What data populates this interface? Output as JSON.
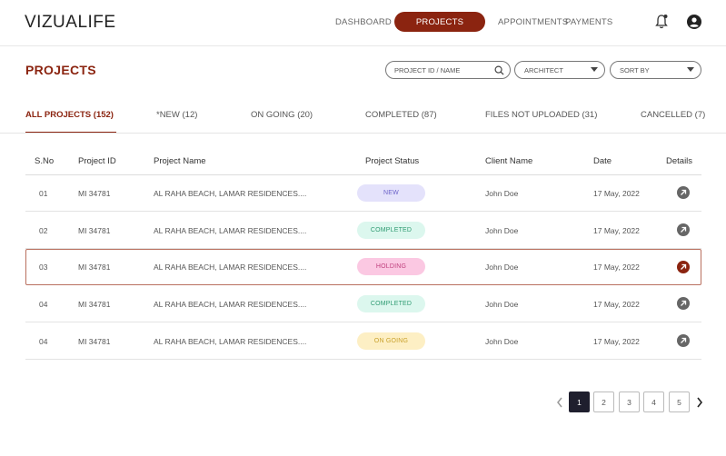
{
  "app": {
    "logo": "VIZUALIFE"
  },
  "nav": {
    "items": [
      {
        "label": "DASHBOARD"
      },
      {
        "label": "PROJECTS"
      },
      {
        "label": "APPOINTMENTS"
      },
      {
        "label": "PAYMENTS"
      }
    ],
    "active": "PROJECTS"
  },
  "header_icons": [
    "bell-icon",
    "user-icon"
  ],
  "page": {
    "title": "PROJECTS"
  },
  "filters": {
    "search_placeholder": "PROJECT ID / NAME",
    "architect": "ARCHITECT",
    "sort": "SORT BY"
  },
  "tabs": [
    {
      "label": "ALL PROJECTS (152)"
    },
    {
      "label": "*NEW (12)"
    },
    {
      "label": "ON GOING (20)"
    },
    {
      "label": "COMPLETED (87)"
    },
    {
      "label": "FILES NOT UPLOADED (31)"
    },
    {
      "label": "CANCELLED (7)"
    }
  ],
  "table": {
    "headers": [
      "S.No",
      "Project ID",
      "Project Name",
      "Project Status",
      "Client Name",
      "Date",
      "Details"
    ],
    "rows": [
      {
        "sno": "01",
        "id": "MI 34781",
        "name": "AL RAHA BEACH, LAMAR RESIDENCES....",
        "status": "NEW",
        "client": "John Doe",
        "date": "17 May, 2022"
      },
      {
        "sno": "02",
        "id": "MI 34781",
        "name": "AL RAHA BEACH, LAMAR RESIDENCES....",
        "status": "COMPLETED",
        "client": "John Doe",
        "date": "17 May, 2022"
      },
      {
        "sno": "03",
        "id": "MI 34781",
        "name": "AL RAHA BEACH, LAMAR RESIDENCES....",
        "status": "HOLDING",
        "client": "John Doe",
        "date": "17 May, 2022"
      },
      {
        "sno": "04",
        "id": "MI 34781",
        "name": "AL RAHA BEACH, LAMAR RESIDENCES....",
        "status": "COMPLETED",
        "client": "John Doe",
        "date": "17 May, 2022"
      },
      {
        "sno": "04",
        "id": "MI 34781",
        "name": "AL RAHA BEACH, LAMAR RESIDENCES....",
        "status": "ON GOING",
        "client": "John Doe",
        "date": "17 May, 2022"
      }
    ]
  },
  "pagination": {
    "pages": [
      "1",
      "2",
      "3",
      "4",
      "5"
    ],
    "current": "1"
  },
  "colors": {
    "accent": "#8b2410",
    "status_new_bg": "#e4e2fb",
    "status_new_fg": "#6c63c9",
    "status_completed_bg": "#dcf7ee",
    "status_completed_fg": "#2f9b72",
    "status_holding_bg": "#fbc8e2",
    "status_holding_fg": "#c0407e",
    "status_ongoing_bg": "#fdefc4",
    "status_ongoing_fg": "#c9a22d"
  }
}
